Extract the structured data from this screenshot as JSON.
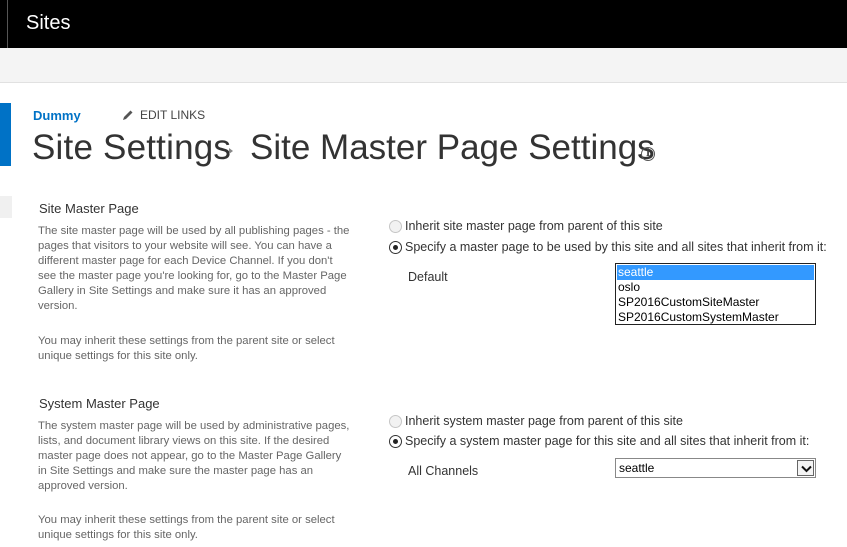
{
  "app": {
    "title": "Sites"
  },
  "nav": {
    "site_link": "Dummy",
    "edit_links": "EDIT LINKS"
  },
  "breadcrumb": {
    "parent": "Site Settings",
    "current": "Site Master Page Settings"
  },
  "site_master": {
    "title": "Site Master Page",
    "description": "The site master page will be used by all publishing pages - the pages that visitors to your website will see. You can have a different master page for each Device Channel. If you don't see the master page you're looking for, go to the Master Page Gallery in Site Settings and make sure it has an approved version.",
    "inherit_note": "You may inherit these settings from the parent site or select unique settings for this site only.",
    "option_inherit": "Inherit site master page from parent of this site",
    "option_specify": "Specify a master page to be used by this site and all sites that inherit from it:",
    "selected_option": "specify",
    "channel_label": "Default",
    "list_options": [
      "seattle",
      "oslo",
      "SP2016CustomSiteMaster",
      "SP2016CustomSystemMaster"
    ],
    "selected_value": "seattle"
  },
  "system_master": {
    "title": "System Master Page",
    "description": "The system master page will be used by administrative pages, lists, and document library views on this site. If the desired master page does not appear, go to the Master Page Gallery in Site Settings and make sure the master page has an approved version.",
    "inherit_note": "You may inherit these settings from the parent site or select unique settings for this site only.",
    "option_inherit": "Inherit system master page from parent of this site",
    "option_specify": "Specify a system master page for this site and all sites that inherit from it:",
    "selected_option": "specify",
    "channel_label": "All Channels",
    "selected_value": "seattle"
  },
  "colors": {
    "accent": "#0072c6",
    "topbar": "#000000",
    "selection": "#3399ff"
  }
}
